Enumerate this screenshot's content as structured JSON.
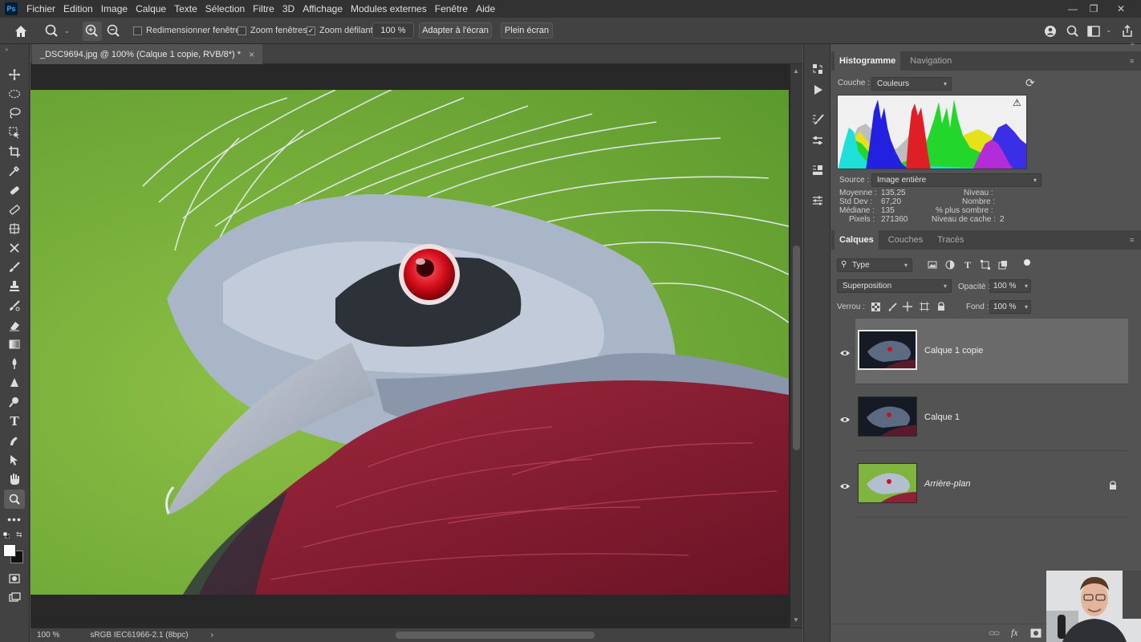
{
  "app": {
    "logo": "Ps",
    "menu": [
      "Fichier",
      "Edition",
      "Image",
      "Calque",
      "Texte",
      "Sélection",
      "Filtre",
      "3D",
      "Affichage",
      "Modules externes",
      "Fenêtre",
      "Aide"
    ]
  },
  "options": {
    "resize_windows": "Redimensionner fenêtres",
    "resize_windows_checked": false,
    "zoom_all": "Zoom fenêtres",
    "zoom_all_checked": false,
    "scrubby_zoom": "Zoom défilant",
    "scrubby_zoom_checked": true,
    "zoom_value": "100 %",
    "fit_screen": "Adapter à l'écran",
    "fill_screen": "Plein écran"
  },
  "document": {
    "tab_title": "_DSC9694.jpg @ 100% (Calque 1 copie, RVB/8*) *",
    "close": "×",
    "status_zoom": "100 %",
    "status_profile": "sRGB IEC61966-2.1 (8bpc)",
    "status_arrow": "›"
  },
  "histogram": {
    "tabs": [
      "Histogramme",
      "Navigation"
    ],
    "channel_label": "Couche :",
    "channel_value": "Couleurs",
    "source_label": "Source :",
    "source_value": "Image entière",
    "stats_left_labels": [
      "Moyenne :",
      "Std Dev :",
      "Médiane :",
      "Pixels :"
    ],
    "stats_left_values": [
      "135,25",
      "67,20",
      "135",
      "271360"
    ],
    "stats_right_labels": [
      "Niveau :",
      "Nombre :",
      "% plus sombre :",
      "Niveau de cache :"
    ],
    "stats_right_values": [
      "",
      "",
      "",
      "2"
    ],
    "warning_icon": "⚠",
    "refresh_icon": "⟳"
  },
  "layers": {
    "tabs": [
      "Calques",
      "Couches",
      "Tracés"
    ],
    "filter_value": "Type",
    "blend_mode": "Superposition",
    "opacity_label": "Opacité :",
    "opacity_value": "100 %",
    "lock_label": "Verrou :",
    "fill_label": "Fond :",
    "fill_value": "100 %",
    "items": [
      {
        "name": "Calque 1 copie",
        "visible": true,
        "selected": true
      },
      {
        "name": "Calque 1",
        "visible": true,
        "selected": false
      },
      {
        "name": "Arrière-plan",
        "visible": true,
        "selected": false,
        "locked": true
      }
    ],
    "footer_icons": [
      "link-icon",
      "fx-icon",
      "mask-icon"
    ],
    "fx_label": "fx"
  },
  "colors": {
    "accent": "#31a8ff",
    "panel_bg": "#535353",
    "chrome_bg": "#424242",
    "menubar_bg": "#323232"
  }
}
